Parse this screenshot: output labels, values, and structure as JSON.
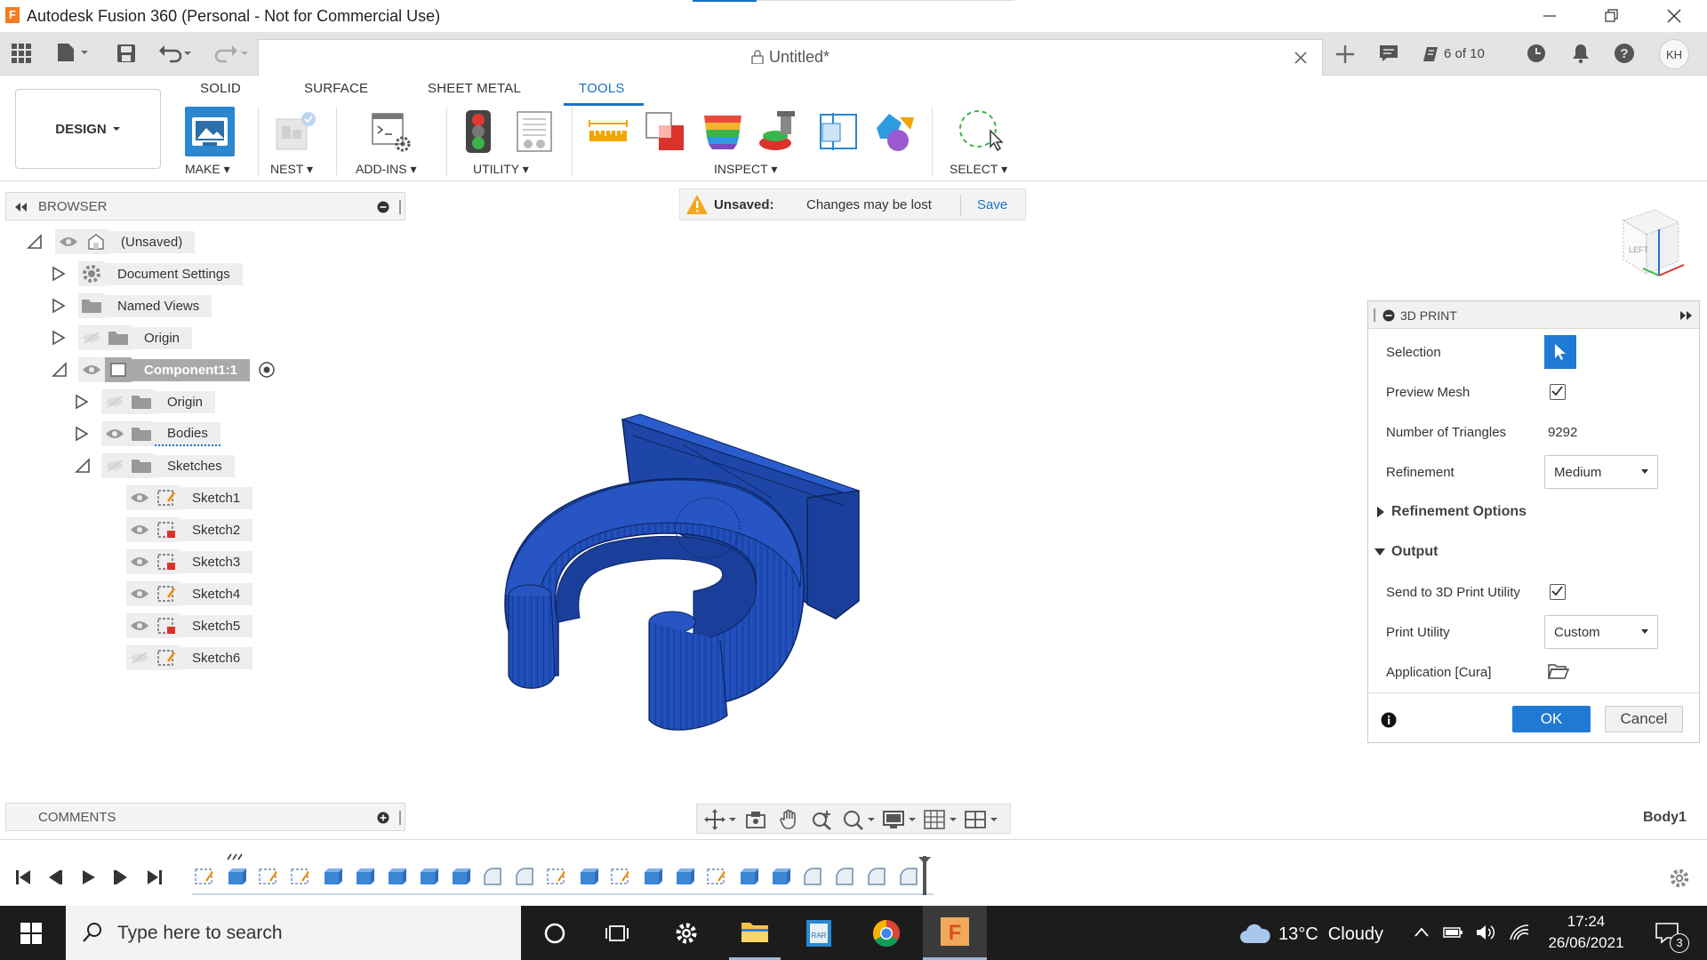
{
  "window": {
    "title": "Autodesk Fusion 360 (Personal - Not for Commercial Use)",
    "app_icon_letter": "F"
  },
  "app_toolbar": {
    "document_title": "Untitled*",
    "job_status": "6 of 10",
    "user_initials": "KH"
  },
  "ribbon": {
    "workspace": "DESIGN",
    "tabs": [
      {
        "label": "SOLID"
      },
      {
        "label": "SURFACE"
      },
      {
        "label": "SHEET METAL"
      },
      {
        "label": "TOOLS"
      }
    ],
    "groups": {
      "make": "MAKE",
      "nest": "NEST",
      "addins": "ADD-INS",
      "utility": "UTILITY",
      "inspect": "INSPECT",
      "select": "SELECT"
    }
  },
  "browser": {
    "header": "BROWSER",
    "tree": {
      "root": "(Unsaved)",
      "document_settings": "Document Settings",
      "named_views": "Named Views",
      "origin": "Origin",
      "component": "Component1:1",
      "comp_origin": "Origin",
      "bodies": "Bodies",
      "sketches": "Sketches",
      "sketch_items": [
        "Sketch1",
        "Sketch2",
        "Sketch3",
        "Sketch4",
        "Sketch5",
        "Sketch6"
      ]
    }
  },
  "unsaved_bar": {
    "label": "Unsaved:",
    "message": "Changes may be lost",
    "save": "Save"
  },
  "print_panel": {
    "title": "3D PRINT",
    "selection_label": "Selection",
    "preview_mesh_label": "Preview Mesh",
    "preview_mesh_checked": true,
    "triangles_label": "Number of Triangles",
    "triangles_value": "9292",
    "refinement_label": "Refinement",
    "refinement_value": "Medium",
    "refinement_options": "Refinement Options",
    "output": "Output",
    "send_label": "Send to 3D Print Utility",
    "send_checked": true,
    "print_utility_label": "Print Utility",
    "print_utility_value": "Custom",
    "application_label": "Application [Cura]",
    "ok": "OK",
    "cancel": "Cancel"
  },
  "comments": {
    "label": "COMMENTS"
  },
  "viewport": {
    "selection_name": "Body1",
    "viewcube_face": "LEFT"
  },
  "taskbar": {
    "search_placeholder": "Type here to search",
    "weather": "13°C  Cloudy",
    "time": "17:24",
    "date": "26/06/2021",
    "notification_count": "3"
  },
  "colors": {
    "accent": "#1a73c7",
    "model_blue": "#1f4db8",
    "taskbar": "#1c1c1c"
  }
}
